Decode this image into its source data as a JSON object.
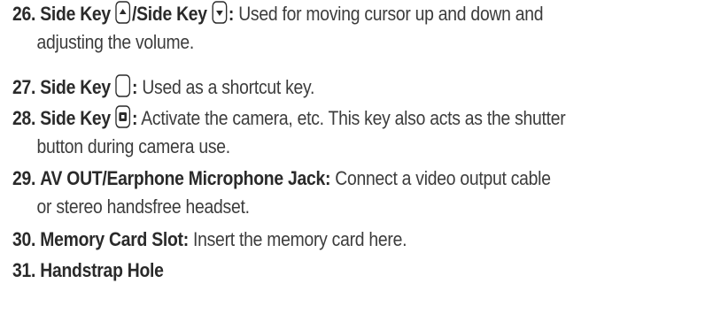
{
  "items": [
    {
      "number": "26.",
      "term_a": "Side Key",
      "icon_a": "up-arrow-key-icon",
      "separator": "/",
      "term_b": "Side Key",
      "icon_b": "down-arrow-key-icon",
      "colon": ":",
      "desc_line1": "Used for moving cursor up and down and",
      "desc_line2": "adjusting the volume."
    },
    {
      "number": "27.",
      "term": "Side Key",
      "icon": "blank-side-key-icon",
      "colon": ":",
      "desc_line1": "Used as a shortcut key."
    },
    {
      "number": "28.",
      "term": "Side Key",
      "icon": "camera-key-icon",
      "colon": ":",
      "desc_line1": "Activate the camera, etc. This key also acts as the shutter",
      "desc_line2": "button during camera use."
    },
    {
      "number": "29.",
      "term": "AV OUT/Earphone Microphone Jack:",
      "desc_line1": "Connect a video output cable",
      "desc_line2": "or stereo handsfree headset."
    },
    {
      "number": "30.",
      "term": "Memory Card Slot:",
      "desc_line1": "Insert the memory card here."
    },
    {
      "number": "31.",
      "term": "Handstrap Hole"
    }
  ]
}
